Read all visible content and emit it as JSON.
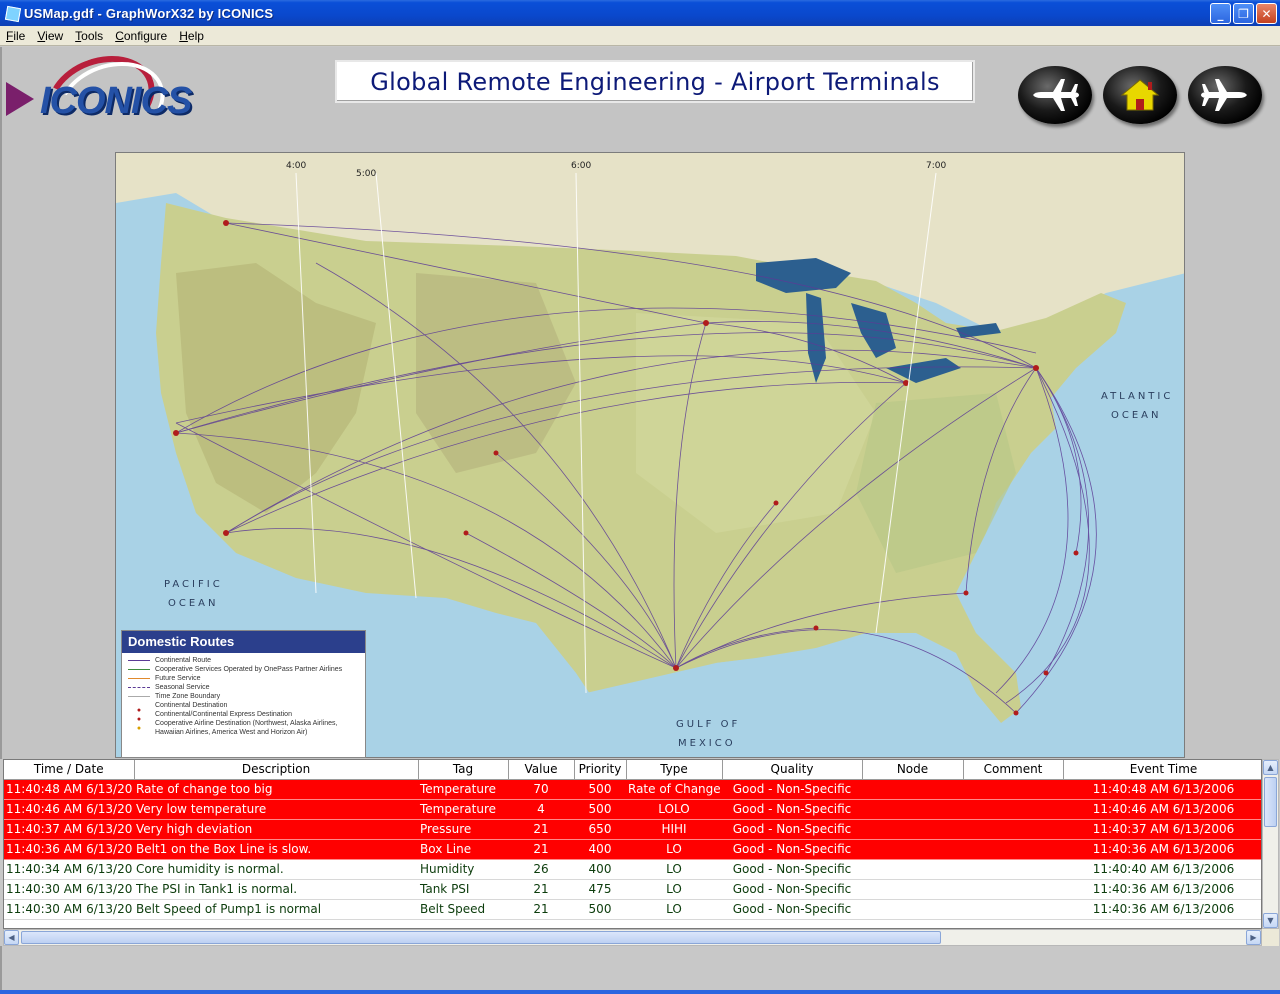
{
  "window": {
    "title": "USMap.gdf - GraphWorX32 by ICONICS",
    "minimize": "_",
    "maximize": "❐",
    "close": "✕"
  },
  "menu": [
    {
      "label": "File",
      "key": "F",
      "rest": "ile"
    },
    {
      "label": "View",
      "key": "V",
      "rest": "iew"
    },
    {
      "label": "Tools",
      "key": "T",
      "rest": "ools"
    },
    {
      "label": "Configure",
      "key": "C",
      "rest": "onfigure"
    },
    {
      "label": "Help",
      "key": "H",
      "rest": "elp"
    }
  ],
  "logo": {
    "text": "ICONICS"
  },
  "header": {
    "title": "Global Remote Engineering - Airport Terminals"
  },
  "nav": {
    "back_icon": "plane-left-icon",
    "home_icon": "home-icon",
    "forward_icon": "plane-right-icon",
    "home_color": "#e8d700"
  },
  "map": {
    "ocean_labels": [
      "ATLANTIC",
      "OCEAN",
      "PACIFIC",
      "OCEAN",
      "GULF OF",
      "MEXICO"
    ],
    "timezones": [
      "4:00",
      "5:00",
      "6:00",
      "7:00"
    ],
    "legend": {
      "title": "Domestic Routes",
      "items": [
        "Continental Route",
        "Cooperative Services Operated by OnePass Partner Airlines",
        "Future Service",
        "Seasonal Service",
        "Time Zone Boundary",
        "Continental Destination",
        "Continental/Continental Express Destination",
        "Cooperative Airline Destination (Northwest, Alaska Airlines,",
        "Hawaiian Airlines, America West and Horizon Air)"
      ]
    }
  },
  "alarms": {
    "columns": [
      "Time / Date",
      "Description",
      "Tag",
      "Value",
      "Priority",
      "Type",
      "Quality",
      "Node",
      "Comment",
      "Event Time"
    ],
    "rows": [
      {
        "state": "alarm",
        "time": "11:40:48 AM  6/13/20",
        "description": "Rate of change too big",
        "tag": "Temperature",
        "value": "70",
        "priority": "500",
        "type": "Rate of Change",
        "quality": "Good - Non-Specific",
        "node": "",
        "comment": "",
        "event": "11:40:48 AM  6/13/2006"
      },
      {
        "state": "alarm",
        "time": "11:40:46 AM  6/13/20",
        "description": "Very low temperature",
        "tag": "Temperature",
        "value": "4",
        "priority": "500",
        "type": "LOLO",
        "quality": "Good - Non-Specific",
        "node": "",
        "comment": "",
        "event": "11:40:46 AM  6/13/2006"
      },
      {
        "state": "alarm",
        "time": "11:40:37 AM  6/13/20",
        "description": "Very high deviation",
        "tag": "Pressure",
        "value": "21",
        "priority": "650",
        "type": "HIHI",
        "quality": "Good - Non-Specific",
        "node": "",
        "comment": "",
        "event": "11:40:37 AM  6/13/2006"
      },
      {
        "state": "alarm",
        "time": "11:40:36 AM  6/13/20",
        "description": "Belt1 on the Box Line is slow.",
        "tag": "Box Line",
        "value": "21",
        "priority": "400",
        "type": "LO",
        "quality": "Good - Non-Specific",
        "node": "",
        "comment": "",
        "event": "11:40:36 AM  6/13/2006"
      },
      {
        "state": "normal",
        "time": "11:40:34 AM  6/13/20",
        "description": "Core humidity is normal.",
        "tag": "Humidity",
        "value": "26",
        "priority": "400",
        "type": "LO",
        "quality": "Good - Non-Specific",
        "node": "",
        "comment": "",
        "event": "11:40:40 AM  6/13/2006"
      },
      {
        "state": "normal",
        "time": "11:40:30 AM  6/13/20",
        "description": "The PSI in Tank1 is normal.",
        "tag": "Tank PSI",
        "value": "21",
        "priority": "475",
        "type": "LO",
        "quality": "Good - Non-Specific",
        "node": "",
        "comment": "",
        "event": "11:40:36 AM  6/13/2006"
      },
      {
        "state": "normal",
        "time": "11:40:30 AM  6/13/20",
        "description": "Belt Speed of Pump1 is normal",
        "tag": "Belt Speed",
        "value": "21",
        "priority": "500",
        "type": "LO",
        "quality": "Good - Non-Specific",
        "node": "",
        "comment": "",
        "event": "11:40:36 AM  6/13/2006"
      }
    ],
    "colors": {
      "alarm_bg": "#ff0000",
      "normal_text": "#0d3d0d"
    }
  }
}
